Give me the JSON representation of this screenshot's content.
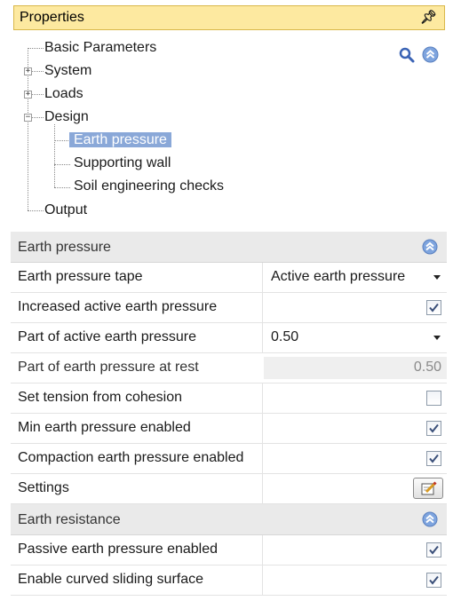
{
  "panel": {
    "title": "Properties",
    "pin_icon": "pin-icon"
  },
  "tree": {
    "items": [
      {
        "label": "Basic Parameters"
      },
      {
        "label": "System",
        "expander": "+"
      },
      {
        "label": "Loads",
        "expander": "+"
      },
      {
        "label": "Design",
        "expander": "−"
      },
      {
        "label": "Earth pressure",
        "selected": true
      },
      {
        "label": "Supporting wall"
      },
      {
        "label": "Soil engineering checks"
      },
      {
        "label": "Output"
      }
    ],
    "tools": [
      "search-icon",
      "collapse-all-icon"
    ]
  },
  "sections": [
    {
      "title": "Earth pressure",
      "rows": [
        {
          "name": "Earth pressure tape",
          "type": "dropdown",
          "value": "Active earth pressure"
        },
        {
          "name": "Increased active earth pressure",
          "type": "checkbox",
          "checked": true
        },
        {
          "name": "Part of active earth pressure",
          "type": "dropdown",
          "value": "0.50"
        },
        {
          "name": "Part of earth pressure at rest",
          "type": "readonly",
          "value": "0.50"
        },
        {
          "name": "Set tension from cohesion",
          "type": "checkbox",
          "checked": false
        },
        {
          "name": "Min earth pressure enabled",
          "type": "checkbox",
          "checked": true
        },
        {
          "name": "Compaction earth pressure enabled",
          "type": "checkbox",
          "checked": true
        },
        {
          "name": "Settings",
          "type": "button",
          "icon": "edit-settings-icon"
        }
      ]
    },
    {
      "title": "Earth resistance",
      "rows": [
        {
          "name": "Passive earth pressure enabled",
          "type": "checkbox",
          "checked": true
        },
        {
          "name": "Enable curved sliding surface",
          "type": "checkbox",
          "checked": true
        }
      ]
    }
  ],
  "colors": {
    "title_bg": "#fde9a0",
    "selection": "#8aa8d8",
    "section_bg": "#eaeaea",
    "check_mark": "#3a4f79"
  }
}
